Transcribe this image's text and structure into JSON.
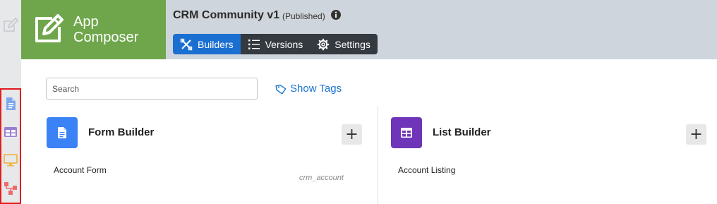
{
  "brand": {
    "line1": "App",
    "line2": "Composer",
    "color": "#6fa64c"
  },
  "app": {
    "title": "CRM Community v1",
    "status": "(Published)"
  },
  "tabs": [
    {
      "label": "Builders",
      "icon": "builders-icon",
      "active": true
    },
    {
      "label": "Versions",
      "icon": "list-icon",
      "active": false
    },
    {
      "label": "Settings",
      "icon": "gear-icon",
      "active": false
    }
  ],
  "search": {
    "placeholder": "Search",
    "value": ""
  },
  "show_tags": {
    "label": "Show Tags"
  },
  "builders": [
    {
      "title": "Form Builder",
      "icon": "document-icon",
      "color": "#3b82f6",
      "items": [
        {
          "name": "Account Form",
          "table": "crm_account"
        }
      ]
    },
    {
      "title": "List Builder",
      "icon": "table-icon",
      "color": "#6f35b8",
      "items": [
        {
          "name": "Account Listing"
        }
      ]
    }
  ],
  "colors": {
    "active_tab": "#1b6fd1",
    "dark_tab": "#343a40",
    "link": "#1b74d1",
    "highlight": "#e31b1b"
  }
}
